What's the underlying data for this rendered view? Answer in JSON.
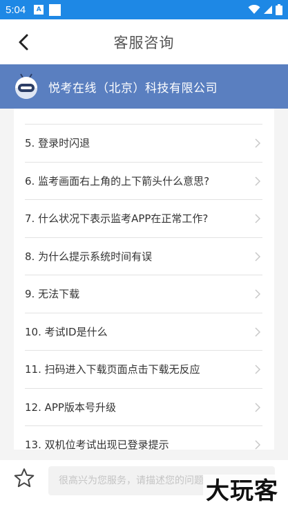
{
  "status_bar": {
    "time": "5:04",
    "notification_icon_letter": "A"
  },
  "header": {
    "title": "客服咨询"
  },
  "company": {
    "name": "悦考在线（北京）科技有限公司"
  },
  "faq": {
    "items": [
      {
        "label": "5.  登录时闪退"
      },
      {
        "label": "6.  监考画面右上角的上下箭头什么意思?"
      },
      {
        "label": "7.  什么状况下表示监考APP在正常工作?"
      },
      {
        "label": "8.  为什么提示系统时间有误"
      },
      {
        "label": "9.  无法下载"
      },
      {
        "label": "10.  考试ID是什么"
      },
      {
        "label": "11.  扫码进入下载页面点击下载无反应"
      },
      {
        "label": "12.  APP版本号升级"
      },
      {
        "label": "13.  双机位考试出现已登录提示"
      }
    ]
  },
  "input": {
    "placeholder": "很高兴为您服务，请描述您的问题"
  },
  "watermark": {
    "text": "大玩客"
  },
  "colors": {
    "status_bar": "#1e88e5",
    "company_band": "#5a7fc0",
    "background": "#f4f4f4"
  }
}
